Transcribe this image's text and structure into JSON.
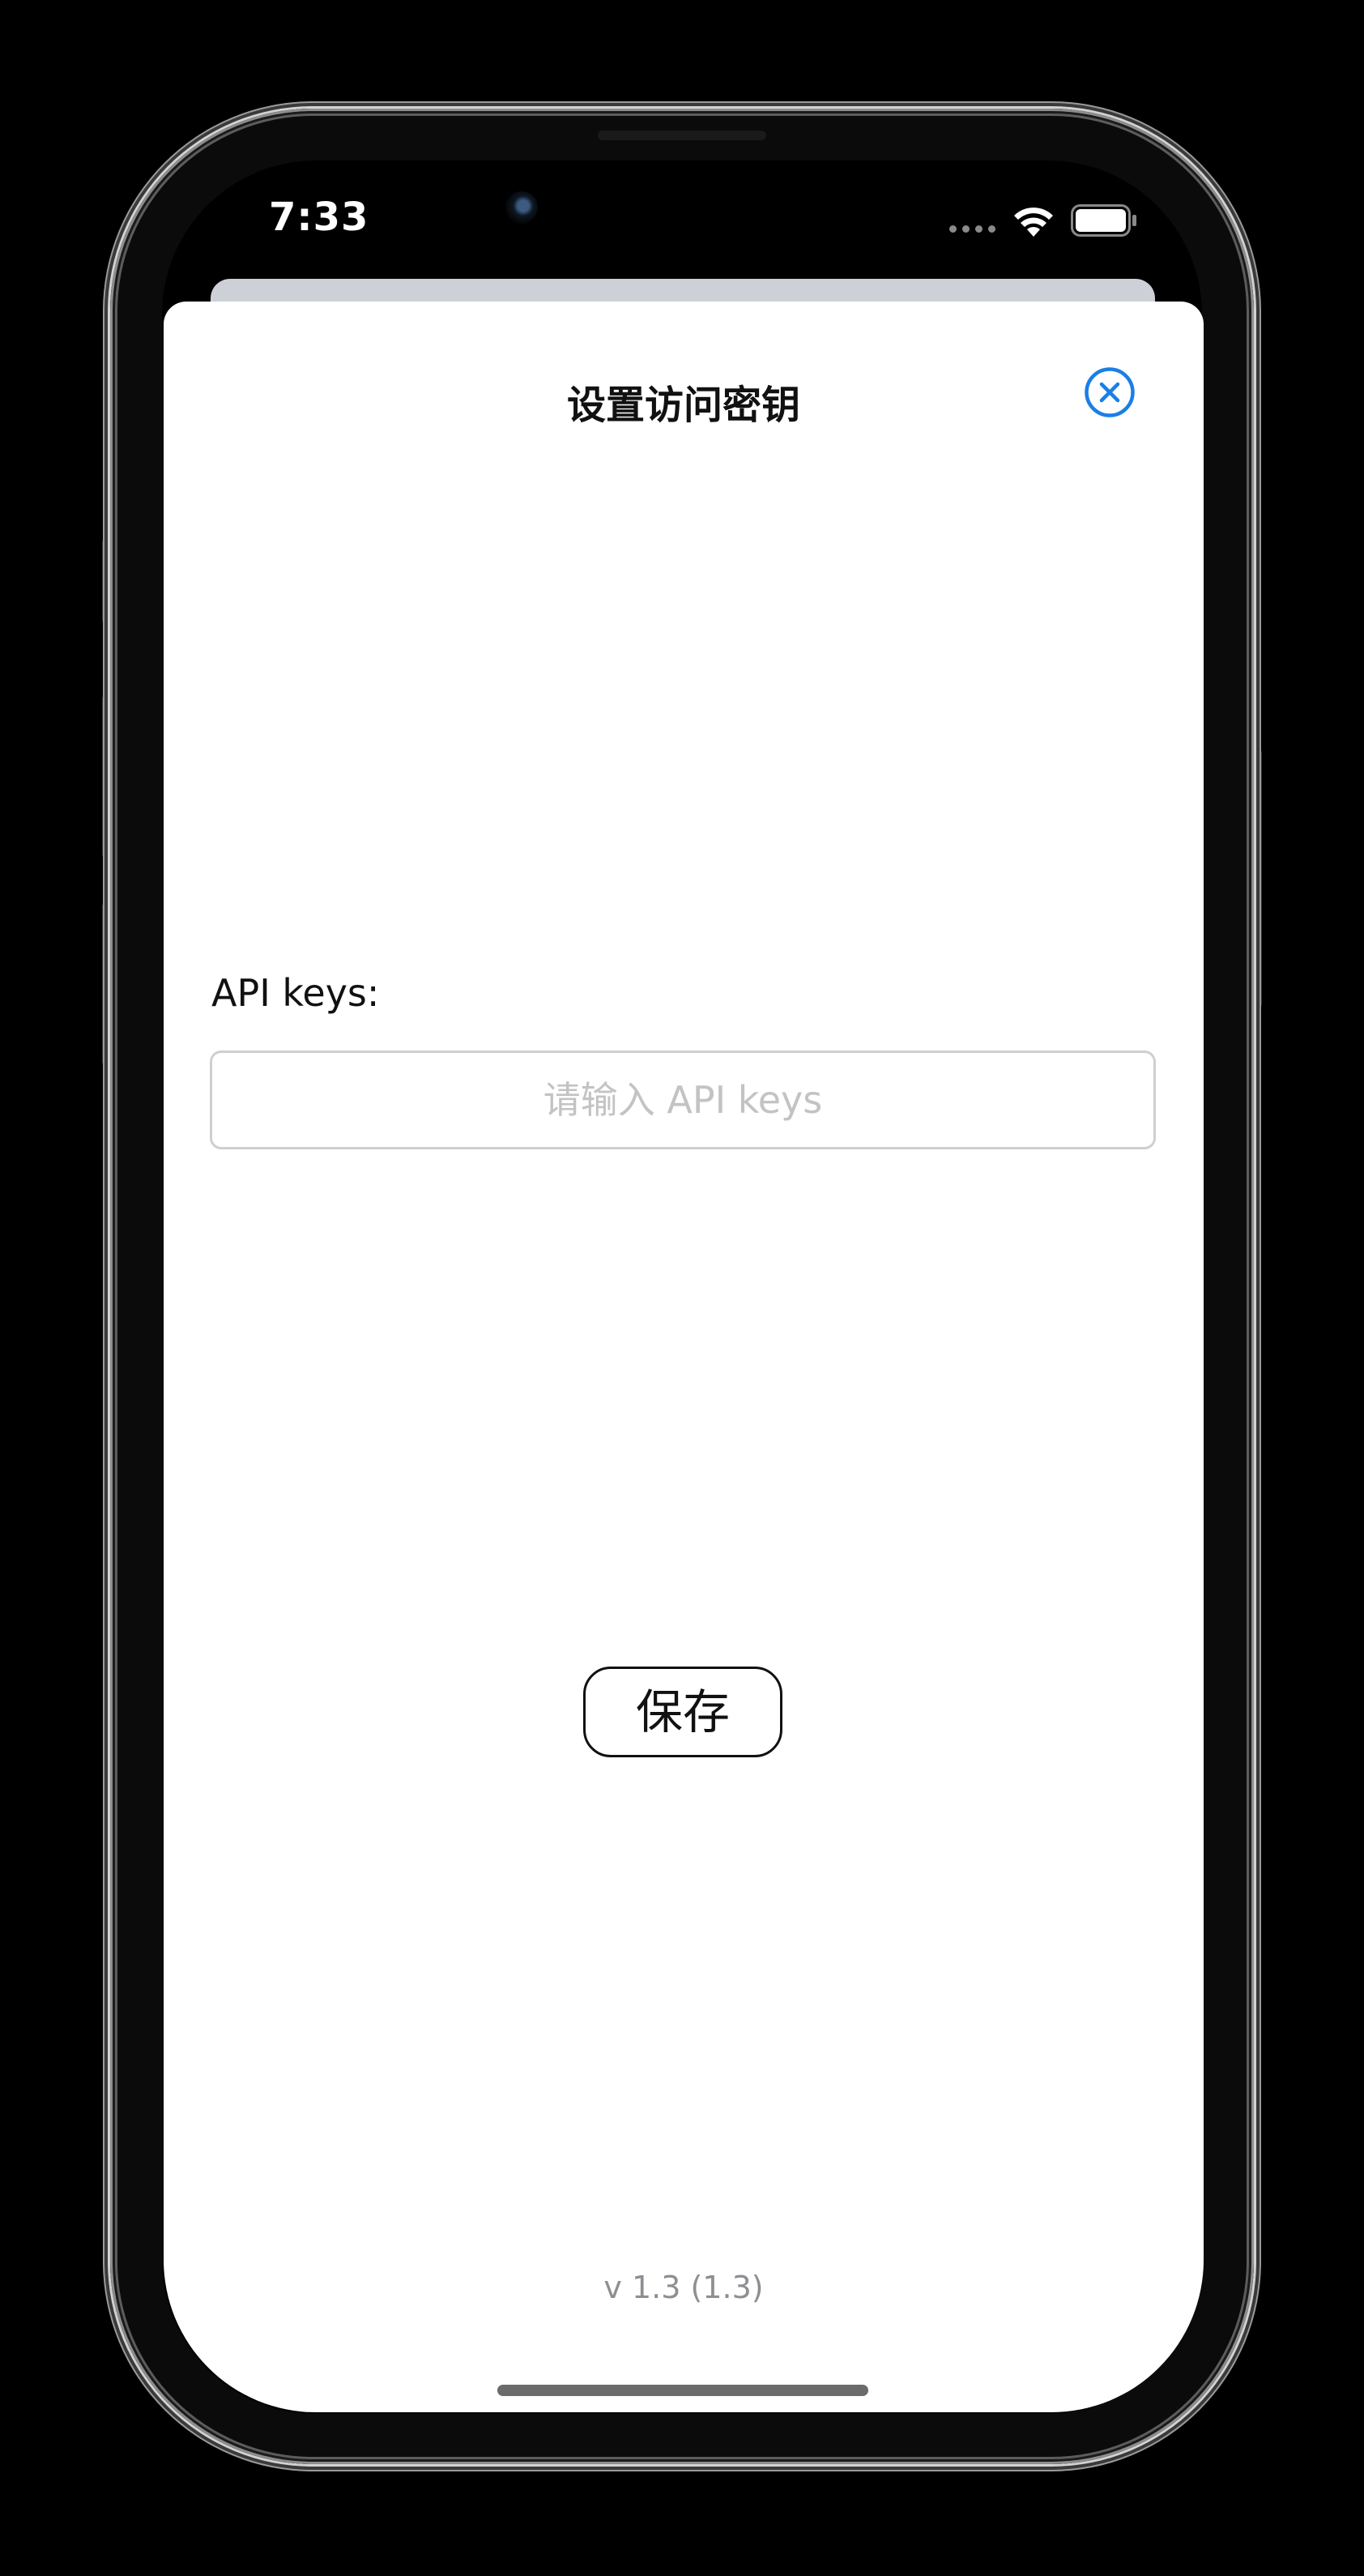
{
  "status_bar": {
    "time": "7:33"
  },
  "sheet": {
    "title": "设置访问密钥",
    "close_icon": "close-circle-icon",
    "field_label": "API keys:",
    "api_input": {
      "value": "",
      "placeholder": "请输入 API keys"
    },
    "save_label": "保存",
    "version": "v 1.3 (1.3)"
  },
  "colors": {
    "accent": "#1a7fe6",
    "sheet_background": "#ffffff",
    "page_background": "#000000",
    "placeholder": "#c3c3c3",
    "version_text": "#8e8e93"
  },
  "icons": {
    "wifi": "wifi-icon",
    "battery": "battery-icon",
    "signal": "signal-dots-icon",
    "close": "close-circle-icon"
  }
}
